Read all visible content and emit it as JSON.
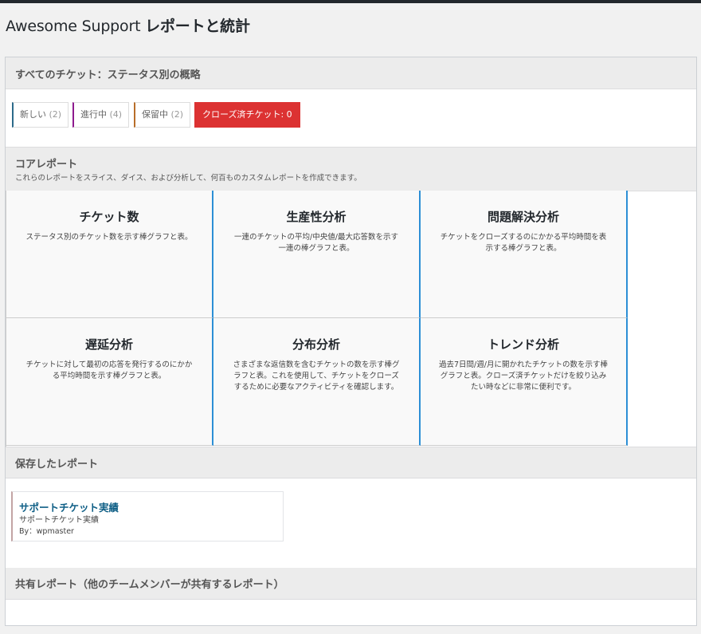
{
  "page": {
    "title_prefix": "Awesome Support ",
    "title_main": "レポートと統計"
  },
  "overview": {
    "heading": "すべてのチケット：ステータス別の概略",
    "statuses": [
      {
        "label": "新しい",
        "count": "(2)",
        "color": "#2c6a8a"
      },
      {
        "label": "進行中",
        "count": "(4)",
        "color": "#8e1a8e"
      },
      {
        "label": "保留中",
        "count": "(2)",
        "color": "#b86e2a"
      }
    ],
    "closed_label": "クローズ済チケット: 0",
    "closed_color": "#dc3232"
  },
  "core": {
    "heading": "コアレポート",
    "description": "これらのレポートをスライス、ダイス、および分析して、何百ものカスタムレポートを作成できます。",
    "cards": [
      {
        "title": "チケット数",
        "desc": "ステータス別のチケット数を示す棒グラフと表。"
      },
      {
        "title": "生産性分析",
        "desc": "一連のチケットの平均/中央値/最大応答数を示す一連の棒グラフと表。"
      },
      {
        "title": "問題解決分析",
        "desc": "チケットをクローズするのにかかる平均時間を表示する棒グラフと表。"
      },
      {
        "title": "遅延分析",
        "desc": "チケットに対して最初の応答を発行するのにかかる平均時間を示す棒グラフと表。"
      },
      {
        "title": "分布分析",
        "desc": "さまざまな返信数を含むチケットの数を示す棒グラフと表。これを使用して、チケットをクローズするために必要なアクティビティを確認します。"
      },
      {
        "title": "トレンド分析",
        "desc": "過去7日間/週/月に開かれたチケットの数を示す棒グラフと表。クローズ済チケットだけを絞り込みたい時などに非常に便利です。"
      }
    ]
  },
  "saved": {
    "heading": "保存したレポート",
    "items": [
      {
        "title": "サポートチケット実績",
        "subtitle": "サポートチケット実績",
        "by": "By：wpmaster"
      }
    ]
  },
  "shared": {
    "heading": "共有レポート（他のチームメンバーが共有するレポート）"
  }
}
